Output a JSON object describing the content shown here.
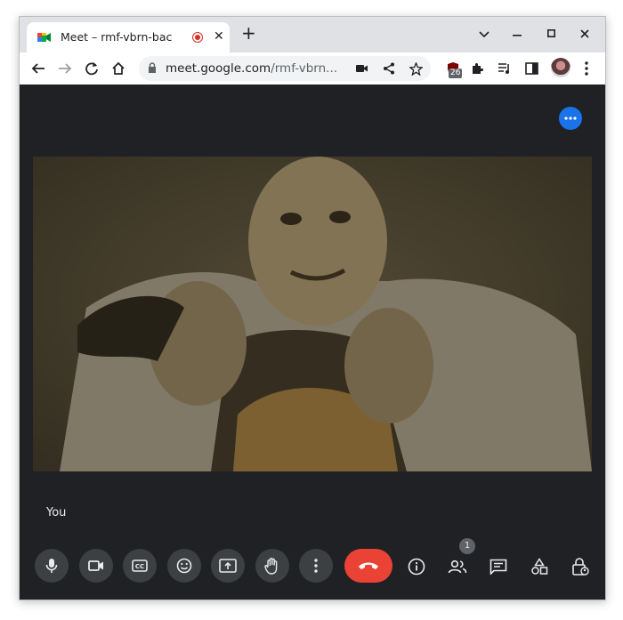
{
  "browser": {
    "tab": {
      "title": "Meet – rmf-vbrn-bac",
      "recording_icon": "record-icon",
      "close_glyph": "✕"
    },
    "new_tab_glyph": "+",
    "window_controls": {
      "dropdown": "⌄",
      "minimize": "–",
      "maximize": "□",
      "close": "✕"
    },
    "omnibox": {
      "host": "meet.google.com",
      "path": "/rmf-vbrn..."
    },
    "extension_badge": "26",
    "icons": [
      "back-arrow-icon",
      "forward-arrow-icon",
      "reload-icon",
      "home-icon",
      "lock-icon",
      "camera-icon",
      "share-icon",
      "star-icon",
      "ublock-icon",
      "puzzle-icon",
      "media-queue-icon",
      "side-panel-icon",
      "profile-avatar",
      "kebab-menu-icon"
    ]
  },
  "meet": {
    "self_label": "You",
    "participants_count": "1",
    "controls": [
      "mic-icon",
      "camera-icon",
      "captions-icon",
      "emoji-icon",
      "present-icon",
      "raise-hand-icon",
      "more-options-icon",
      "end-call-icon"
    ],
    "side_controls": [
      "info-icon",
      "people-icon",
      "chat-icon",
      "activities-icon",
      "host-controls-icon"
    ],
    "colors": {
      "background": "#202124",
      "button": "#3c4043",
      "end_call": "#ea4335",
      "accent": "#1a73e8"
    }
  }
}
